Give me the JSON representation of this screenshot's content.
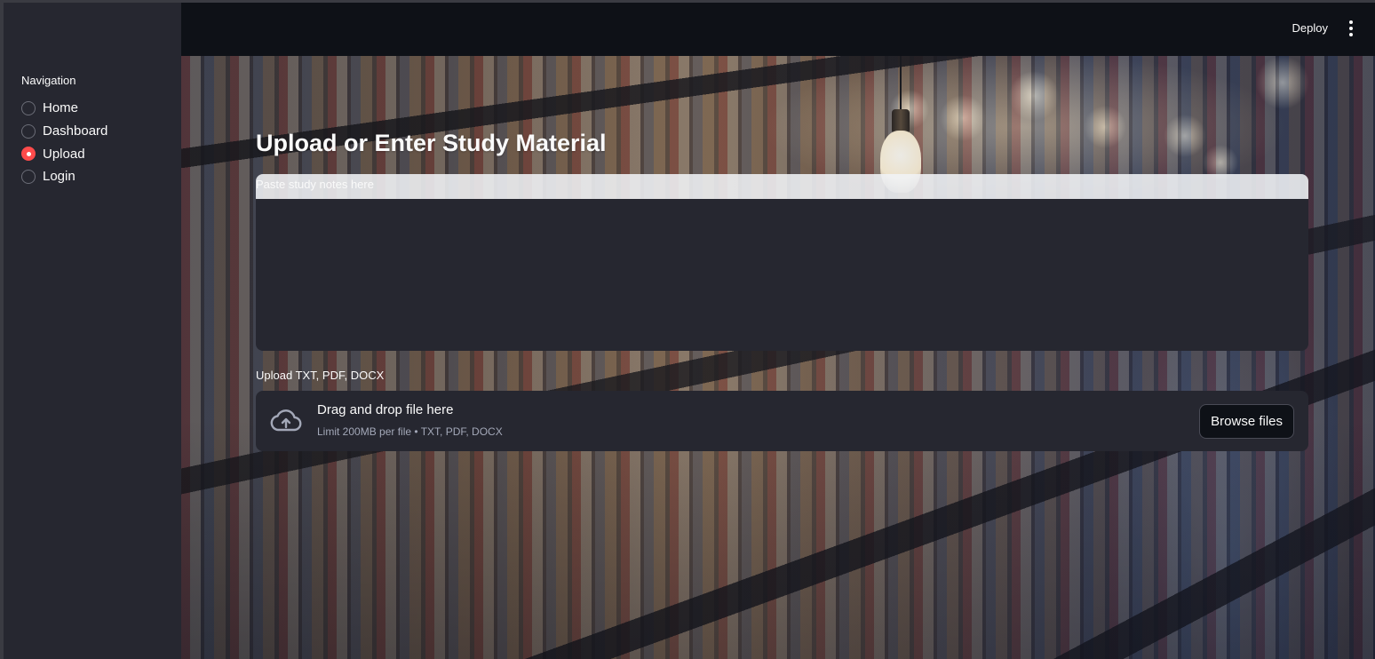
{
  "sidebar": {
    "nav_label": "Navigation",
    "items": [
      {
        "label": "Home",
        "checked": false
      },
      {
        "label": "Dashboard",
        "checked": false
      },
      {
        "label": "Upload",
        "checked": true
      },
      {
        "label": "Login",
        "checked": false
      }
    ]
  },
  "header": {
    "deploy_label": "Deploy",
    "menu_icon": "kebab-menu-icon"
  },
  "main": {
    "title": "Upload or Enter Study Material",
    "notes": {
      "label": "Paste study notes here",
      "value": ""
    },
    "uploader": {
      "label": "Upload TXT, PDF, DOCX",
      "drag_text": "Drag and drop file here",
      "limit_text": "Limit 200MB per file • TXT, PDF, DOCX",
      "browse_label": "Browse files",
      "icon": "cloud-upload-icon"
    }
  },
  "colors": {
    "sidebar_bg": "#262730",
    "header_bg": "#0e1117",
    "accent": "#ff4b4b",
    "input_bg": "#262730"
  }
}
